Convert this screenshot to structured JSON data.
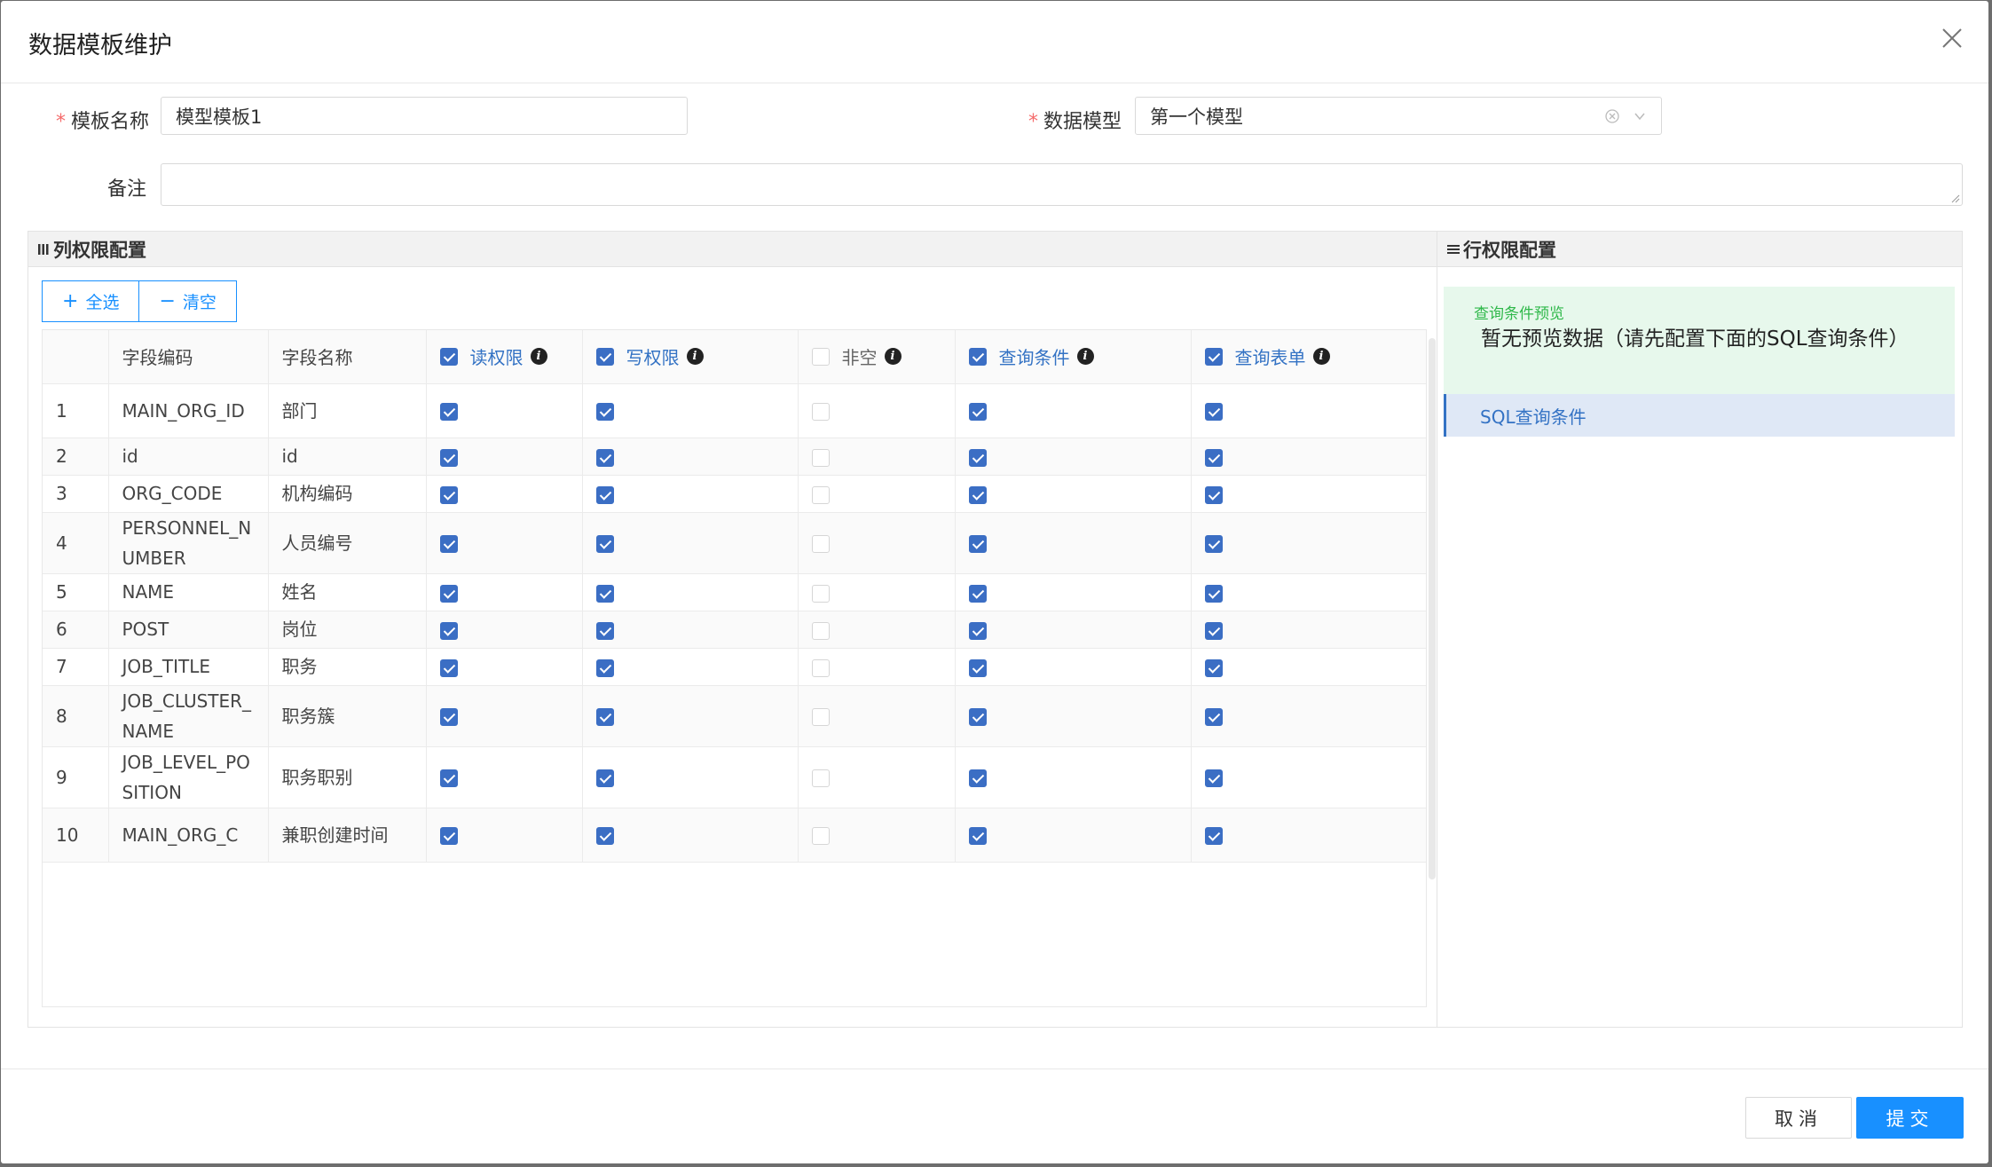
{
  "dialog": {
    "title": "数据模板维护",
    "close_icon": "close-icon"
  },
  "form": {
    "template_name_label": "模板名称",
    "template_name_value": "模型模板1",
    "required_mark": "*",
    "data_model_label": "数据模型",
    "data_model_value": "第一个模型",
    "remark_label": "备注",
    "remark_value": ""
  },
  "column_panel": {
    "title": "列权限配置",
    "title_icon": "column-grid-icon",
    "select_all": "全选",
    "clear": "清空",
    "headers": {
      "index": "",
      "field_code": "字段编码",
      "field_name": "字段名称",
      "read": "读权限",
      "write": "写权限",
      "not_null": "非空",
      "query_cond": "查询条件",
      "query_form": "查询表单"
    },
    "header_checks": {
      "read": true,
      "write": true,
      "not_null": false,
      "query_cond": true,
      "query_form": true
    },
    "rows": [
      {
        "idx": "1",
        "code": "MAIN_ORG_ID",
        "name": "部门",
        "read": true,
        "write": true,
        "not_null": false,
        "query_cond": true,
        "query_form": true
      },
      {
        "idx": "2",
        "code": "id",
        "name": "id",
        "read": true,
        "write": true,
        "not_null": false,
        "query_cond": true,
        "query_form": true
      },
      {
        "idx": "3",
        "code": "ORG_CODE",
        "name": "机构编码",
        "read": true,
        "write": true,
        "not_null": false,
        "query_cond": true,
        "query_form": true
      },
      {
        "idx": "4",
        "code": "PERSONNEL_NUMBER",
        "name": "人员编号",
        "read": true,
        "write": true,
        "not_null": false,
        "query_cond": true,
        "query_form": true
      },
      {
        "idx": "5",
        "code": "NAME",
        "name": "姓名",
        "read": true,
        "write": true,
        "not_null": false,
        "query_cond": true,
        "query_form": true
      },
      {
        "idx": "6",
        "code": "POST",
        "name": "岗位",
        "read": true,
        "write": true,
        "not_null": false,
        "query_cond": true,
        "query_form": true
      },
      {
        "idx": "7",
        "code": "JOB_TITLE",
        "name": "职务",
        "read": true,
        "write": true,
        "not_null": false,
        "query_cond": true,
        "query_form": true
      },
      {
        "idx": "8",
        "code": "JOB_CLUSTER_NAME",
        "name": "职务簇",
        "read": true,
        "write": true,
        "not_null": false,
        "query_cond": true,
        "query_form": true
      },
      {
        "idx": "9",
        "code": "JOB_LEVEL_POSITION",
        "name": "职务职别",
        "read": true,
        "write": true,
        "not_null": false,
        "query_cond": true,
        "query_form": true
      },
      {
        "idx": "10",
        "code": "MAIN_ORG_C",
        "name": "兼职创建时间",
        "read": true,
        "write": true,
        "not_null": false,
        "query_cond": true,
        "query_form": true
      }
    ]
  },
  "row_panel": {
    "title": "行权限配置",
    "title_icon": "list-lines-icon",
    "preview_label": "查询条件预览",
    "preview_text": "暂无预览数据（请先配置下面的SQL查询条件）",
    "sql_item": "SQL查询条件"
  },
  "footer": {
    "cancel": "取消",
    "submit": "提交"
  },
  "colors": {
    "primary": "#1890ff",
    "checkbox": "#3b6ec4",
    "preview_bg": "#e7f8ec",
    "preview_label": "#2fb84a",
    "required": "#f56c6c"
  }
}
